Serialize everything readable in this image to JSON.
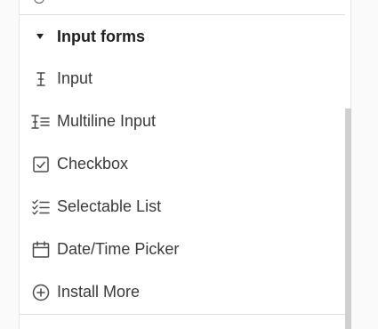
{
  "section": {
    "title": "Input forms",
    "items": [
      {
        "label": "Input",
        "icon": "text-cursor-icon"
      },
      {
        "label": "Multiline Input",
        "icon": "multiline-input-icon"
      },
      {
        "label": "Checkbox",
        "icon": "checkbox-icon"
      },
      {
        "label": "Selectable List",
        "icon": "checklist-icon"
      },
      {
        "label": "Date/Time Picker",
        "icon": "calendar-icon"
      },
      {
        "label": "Install More",
        "icon": "plus-circle-icon"
      }
    ]
  },
  "colors": {
    "text": "#3a3a3a",
    "header_text": "#1f1f1f",
    "icon": "#4a4a4a",
    "divider": "#dedede",
    "scrollbar": "#cfcfcf"
  }
}
